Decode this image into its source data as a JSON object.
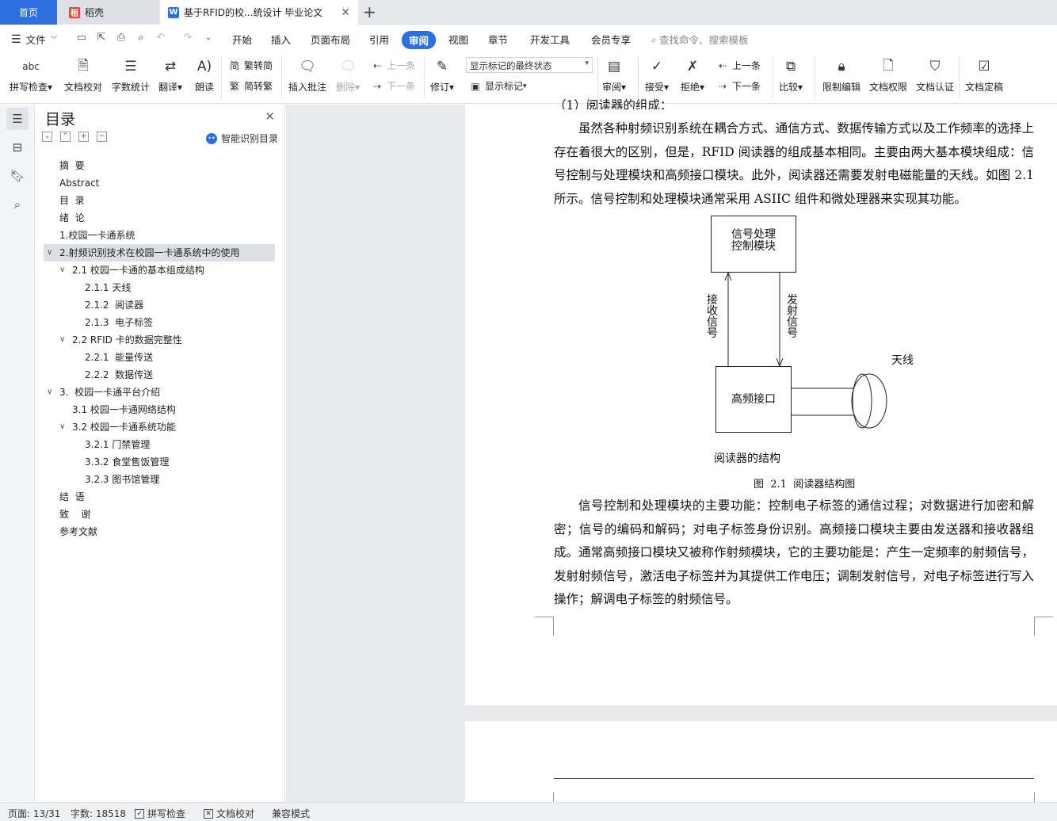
{
  "tabs": {
    "home": "首页",
    "daoke": "稻壳",
    "doc": "基于RFID的校...统设计 毕业论文"
  },
  "menu": {
    "file": "文件",
    "items": [
      "开始",
      "插入",
      "页面布局",
      "引用",
      "审阅",
      "视图",
      "章节",
      "开发工具",
      "会员专享"
    ],
    "active": "审阅",
    "search": "查找命令、搜索模板"
  },
  "ribbon": {
    "spell": "拼写检查",
    "proof": "文档校对",
    "count": "字数统计",
    "translate": "翻译",
    "read": "朗读",
    "trad": "繁转简",
    "simp": "简转繁",
    "insert_comment": "插入批注",
    "delete": "删除",
    "prev": "上一条",
    "next": "下一条",
    "revise": "修订",
    "markup_state": "显示标记的最终状态",
    "show_markup": "显示标记",
    "review": "审阅",
    "accept": "接受",
    "reject": "拒绝",
    "prev2": "上一条",
    "next2": "下一条",
    "compare": "比较",
    "restrict": "限制编辑",
    "permission": "文档权限",
    "certify": "文档认证",
    "finalize": "文档定稿",
    "abc": "abc"
  },
  "toc": {
    "title": "目录",
    "smart": "智能识别目录",
    "items": [
      {
        "label": "摘  要",
        "level": 0
      },
      {
        "label": "Abstract",
        "level": 0
      },
      {
        "label": "目  录",
        "level": 0
      },
      {
        "label": "绪  论",
        "level": 0
      },
      {
        "label": "1.校园一卡通系统",
        "level": 0
      },
      {
        "label": "2.射频识别技术在校园一卡通系统中的使用",
        "level": 0,
        "expanded": true,
        "selected": true
      },
      {
        "label": "2.1 校园一卡通的基本组成结构",
        "level": 1,
        "expanded": true
      },
      {
        "label": "2.1.1 天线",
        "level": 2
      },
      {
        "label": "2.1.2  阅读器",
        "level": 2
      },
      {
        "label": "2.1.3  电子标签",
        "level": 2
      },
      {
        "label": "2.2 RFID 卡的数据完整性",
        "level": 1,
        "expanded": true
      },
      {
        "label": "2.2.1  能量传送",
        "level": 2
      },
      {
        "label": "2.2.2  数据传送",
        "level": 2
      },
      {
        "label": "3.  校园一卡通平台介绍",
        "level": 0,
        "expanded": true
      },
      {
        "label": "3.1 校园一卡通网络结构",
        "level": 1
      },
      {
        "label": "3.2 校园一卡通系统功能",
        "level": 1,
        "expanded": true
      },
      {
        "label": "3.2.1 门禁管理",
        "level": 2
      },
      {
        "label": "3.3.2 食堂售饭管理",
        "level": 2
      },
      {
        "label": "3.2.3 图书馆管理",
        "level": 2
      },
      {
        "label": "结  语",
        "level": 0
      },
      {
        "label": "致    谢",
        "level": 0
      },
      {
        "label": "参考文献",
        "level": 0
      }
    ]
  },
  "document": {
    "heading_partial": "（1）阅读器的组成：",
    "para1": "虽然各种射频识别系统在耦合方式、通信方式、数据传输方式以及工作频率的选择上存在着很大的区别，但是，RFID 阅读器的组成基本相同。主要由两大基本模块组成：信号控制与处理模块和高频接口模块。此外，阅读器还需要发射电磁能量的天线。如图 2.1 所示。信号控制和处理模块通常采用 ASIIC 组件和微处理器来实现其功能。",
    "figure": {
      "box_top_line1": "信号处理",
      "box_top_line2": "控制模块",
      "receive": "接收信号",
      "transmit": "发射信号",
      "antenna": "天线",
      "box_bottom": "高频接口",
      "inner_caption": "阅读器的结构",
      "caption": "图  2.1  阅读器结构图"
    },
    "para2": "信号控制和处理模块的主要功能：控制电子标签的通信过程；对数据进行加密和解密；信号的编码和解码；对电子标签身份识别。高频接口模块主要由发送器和接收器组成。通常高频接口模块又被称作射频模块，它的主要功能是：产生一定频率的射频信号，发射射频信号，激活电子标签并为其提供工作电压；调制发射信号，对电子标签进行写入操作；解调电子标签的射频信号。"
  },
  "status": {
    "page": "页面: 13/31",
    "words": "字数: 18518",
    "spell": "拼写检查",
    "proof": "文档校对",
    "compat": "兼容模式"
  }
}
